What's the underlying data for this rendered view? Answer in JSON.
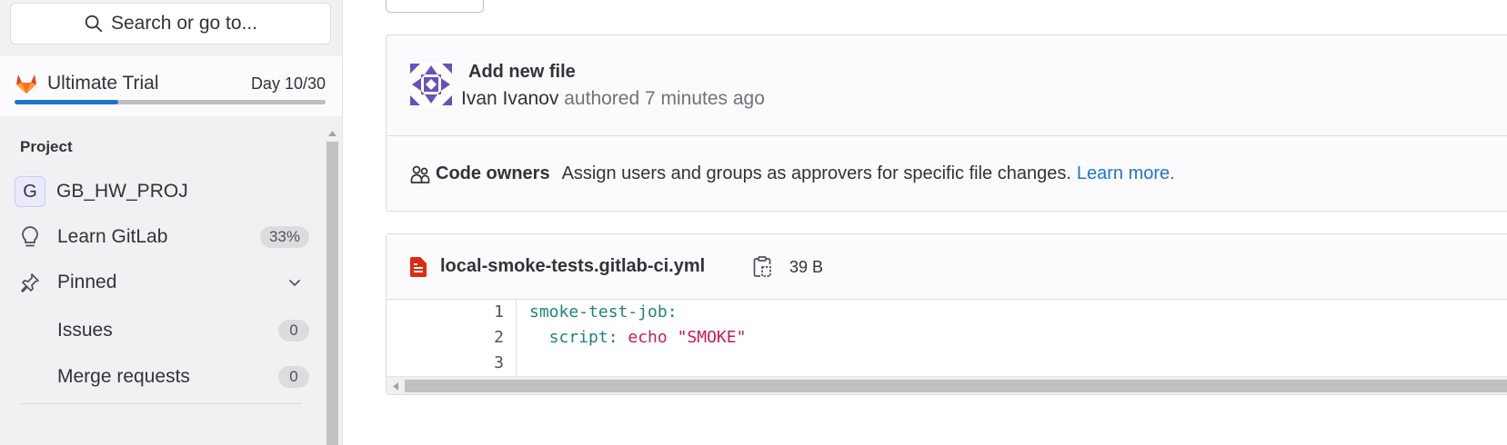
{
  "sidebar": {
    "search_label": "Search or go to...",
    "trial": {
      "name": "Ultimate Trial",
      "day_label": "Day 10/30",
      "progress": 0.333
    },
    "section_title": "Project",
    "project": {
      "initial": "G",
      "name": "GB_HW_PROJ"
    },
    "learn": {
      "label": "Learn GitLab",
      "badge": "33%"
    },
    "pinned": {
      "label": "Pinned"
    },
    "pinned_items": [
      {
        "label": "Issues",
        "count": "0"
      },
      {
        "label": "Merge requests",
        "count": "0"
      }
    ]
  },
  "commit": {
    "title": "Add new file",
    "author": "Ivan Ivanov",
    "meta": "authored 7 minutes ago"
  },
  "code_owners": {
    "label": "Code owners",
    "text": "Assign users and groups as approvers for specific file changes.",
    "link": "Learn more."
  },
  "file": {
    "name": "local-smoke-tests.gitlab-ci.yml",
    "size": "39 B",
    "lines": [
      {
        "n": "1",
        "key": "smoke-test-job:",
        "cmd": "",
        "str": ""
      },
      {
        "n": "2",
        "key": "  script: ",
        "cmd": "echo ",
        "str": "\"SMOKE\""
      },
      {
        "n": "3",
        "key": "",
        "cmd": "",
        "str": ""
      }
    ]
  },
  "colors": {
    "accent": "#1f75cb",
    "yaml_key": "#22827a",
    "yaml_value": "#c91c5d",
    "file_icon": "#dd2b0e"
  }
}
